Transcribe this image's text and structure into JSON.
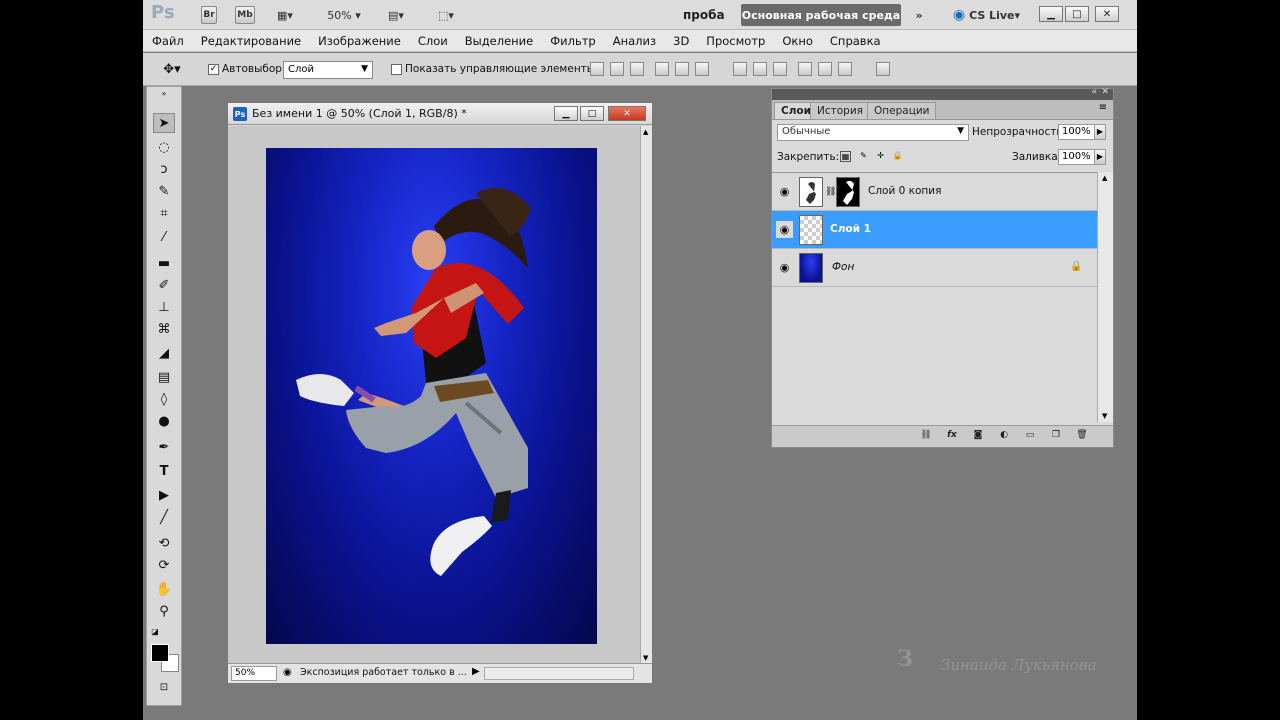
{
  "appbar": {
    "logo": "Ps",
    "zoom": "50%",
    "workspace_name": "проба",
    "workspace_active": "Основная рабочая среда",
    "more": "»",
    "cs_live": "CS Live",
    "bridge": "Br",
    "mini_bridge": "Mb"
  },
  "menu": {
    "items": [
      "Файл",
      "Редактирование",
      "Изображение",
      "Слои",
      "Выделение",
      "Фильтр",
      "Анализ",
      "3D",
      "Просмотр",
      "Окно",
      "Справка"
    ]
  },
  "options": {
    "autoselect_label": "Автовыбор:",
    "autoselect_value": "Слой",
    "show_controls_label": "Показать управляющие элементы"
  },
  "document": {
    "title": "Без имени 1 @ 50% (Слой 1, RGB/8) *",
    "zoom": "50%",
    "status": "Экспозиция работает только в ..."
  },
  "layers_panel": {
    "tabs": [
      "Слои",
      "История",
      "Операции"
    ],
    "blend_mode": "Обычные",
    "opacity_label": "Непрозрачность:",
    "opacity_value": "100%",
    "lock_label": "Закрепить:",
    "fill_label": "Заливка:",
    "fill_value": "100%",
    "layers": [
      {
        "name": "Слой 0 копия",
        "selected": false
      },
      {
        "name": "Слой 1",
        "selected": true
      },
      {
        "name": "Фон",
        "selected": false
      }
    ]
  },
  "watermark": {
    "mark": "З",
    "signature": "Зинаида Лукьянова"
  },
  "colors": {
    "selection": "#3b9cff",
    "canvas_bg": "#1626c8"
  }
}
